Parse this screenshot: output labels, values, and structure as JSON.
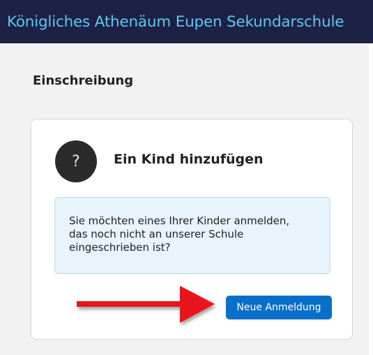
{
  "header": {
    "school_name": "Königliches Athenäum Eupen Sekundarschule"
  },
  "section": {
    "title": "Einschreibung"
  },
  "card": {
    "icon_glyph": "?",
    "icon": "question-mark-icon",
    "title": "Ein Kind hinzufügen",
    "info_lines": [
      "Sie möchten eines Ihrer Kinder anmelden,",
      "das noch nicht an unserer Schule",
      "eingeschrieben ist?"
    ],
    "button_label": "Neue Anmeldung"
  },
  "annotation": {
    "icon": "red-arrow-icon",
    "color": "#e8131a"
  },
  "colors": {
    "header_bg": "#1c2145",
    "header_text": "#5ec8f0",
    "button_bg": "#0a6fc9",
    "info_bg": "#e9f3fc"
  }
}
